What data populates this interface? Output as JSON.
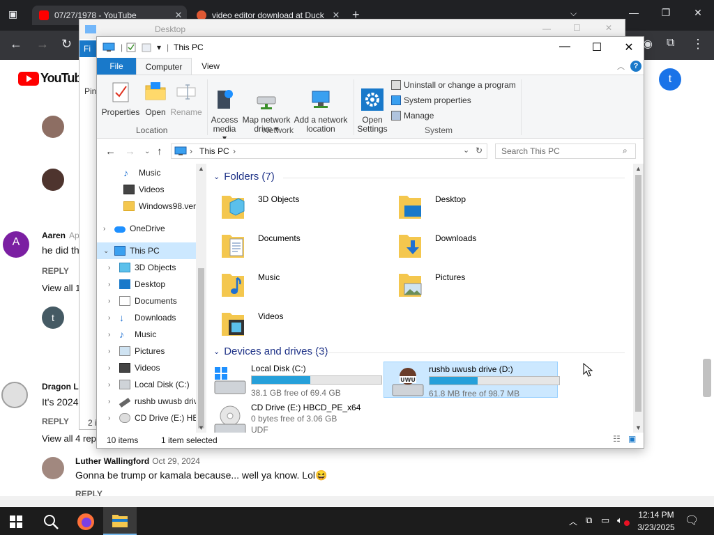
{
  "browser": {
    "tabs": [
      {
        "title": "07/27/1978 - YouTube",
        "close": "✕"
      },
      {
        "title": "video editor download at Duck",
        "close": "✕"
      }
    ],
    "new_tab": "+",
    "tab_search": "⌵",
    "window_controls": {
      "minimize": "—",
      "restore": "❐",
      "close": "✕"
    },
    "nav": {
      "back": "←",
      "forward": "→",
      "reload": "↻",
      "extensions": "⧉",
      "menu": "⋮"
    }
  },
  "youtube": {
    "logo_text": "YouTube",
    "avatar_letter": "t",
    "comments": [
      {
        "author": "Aaren",
        "date": "Ap",
        "text": "he did th",
        "reply": "REPLY",
        "view": "View all 1"
      },
      {
        "author": "Dragon L",
        "date": "",
        "text": "It's 2024",
        "reply": "REPLY",
        "view": "View all 4 rep"
      },
      {
        "author": "Luther Wallingford",
        "date": "Oct 29, 2024",
        "text": "Gonna be trump or kamala because... well ya know. Lol😆",
        "reply": "REPLY",
        "view": ""
      }
    ],
    "other_avatars": [
      {
        "letter": "A",
        "color": "#7b1fa2"
      },
      {
        "letter": "t",
        "color": "#455a64"
      }
    ]
  },
  "back_window": {
    "title": "Desktop",
    "tab_file": "Fi",
    "pin_label": "Pin",
    "count_label": "2 i"
  },
  "explorer": {
    "title": "This PC",
    "window_controls": {
      "minimize": "—",
      "maximize": "☐",
      "close": "✕"
    },
    "ribbon_tabs": [
      "File",
      "Computer",
      "View"
    ],
    "ribbon": {
      "location": {
        "group": "Location",
        "buttons": [
          {
            "label": "Properties",
            "icon": "properties-icon"
          },
          {
            "label": "Open",
            "icon": "open-folder-icon"
          },
          {
            "label": "Rename",
            "icon": "rename-icon"
          }
        ]
      },
      "network": {
        "group": "Network",
        "buttons": [
          {
            "label": "Access\nmedia ▾",
            "icon": "access-media-icon"
          },
          {
            "label": "Map network\ndrive ▾",
            "icon": "map-drive-icon"
          },
          {
            "label": "Add a network\nlocation",
            "icon": "network-location-icon"
          }
        ]
      },
      "system": {
        "group": "System",
        "open_settings": "Open\nSettings",
        "items": [
          "Uninstall or change a program",
          "System properties",
          "Manage"
        ]
      }
    },
    "address": {
      "path": "This PC",
      "placeholder": "Search This PC"
    },
    "nav_pane": [
      {
        "label": "Music",
        "level": 2,
        "chev": ""
      },
      {
        "label": "Videos",
        "level": 2,
        "chev": ""
      },
      {
        "label": "Windows98.ver.4",
        "level": 2,
        "chev": ""
      },
      {
        "label": "OneDrive",
        "level": 1,
        "chev": "›"
      },
      {
        "label": "This PC",
        "level": 1,
        "chev": "⌄",
        "selected": true
      },
      {
        "label": "3D Objects",
        "level": 2,
        "chev": "›"
      },
      {
        "label": "Desktop",
        "level": 2,
        "chev": "›"
      },
      {
        "label": "Documents",
        "level": 2,
        "chev": "›"
      },
      {
        "label": "Downloads",
        "level": 2,
        "chev": "›"
      },
      {
        "label": "Music",
        "level": 2,
        "chev": "›"
      },
      {
        "label": "Pictures",
        "level": 2,
        "chev": "›"
      },
      {
        "label": "Videos",
        "level": 2,
        "chev": "›"
      },
      {
        "label": "Local Disk (C:)",
        "level": 2,
        "chev": "›"
      },
      {
        "label": "rushb uwusb driv",
        "level": 2,
        "chev": "›"
      },
      {
        "label": "CD Drive (E:) HB",
        "level": 2,
        "chev": "›"
      }
    ],
    "folders_header": "Folders (7)",
    "folders": [
      "3D Objects",
      "Desktop",
      "Documents",
      "Downloads",
      "Music",
      "Pictures",
      "Videos"
    ],
    "drives_header": "Devices and drives (3)",
    "drives": [
      {
        "name": "Local Disk (C:)",
        "free": "38.1 GB free of 69.4 GB",
        "used_fraction": 0.45
      },
      {
        "name": "rushb uwusb drive (D:)",
        "free": "61.8 MB free of 98.7 MB",
        "used_fraction": 0.37,
        "selected": true
      },
      {
        "name": "CD Drive (E:) HBCD_PE_x64",
        "free": "0 bytes free of 3.06 GB",
        "fs": "UDF"
      }
    ],
    "status": {
      "items": "10 items",
      "selected": "1 item selected"
    }
  },
  "taskbar": {
    "time": "12:14 PM",
    "date": "3/23/2025"
  }
}
